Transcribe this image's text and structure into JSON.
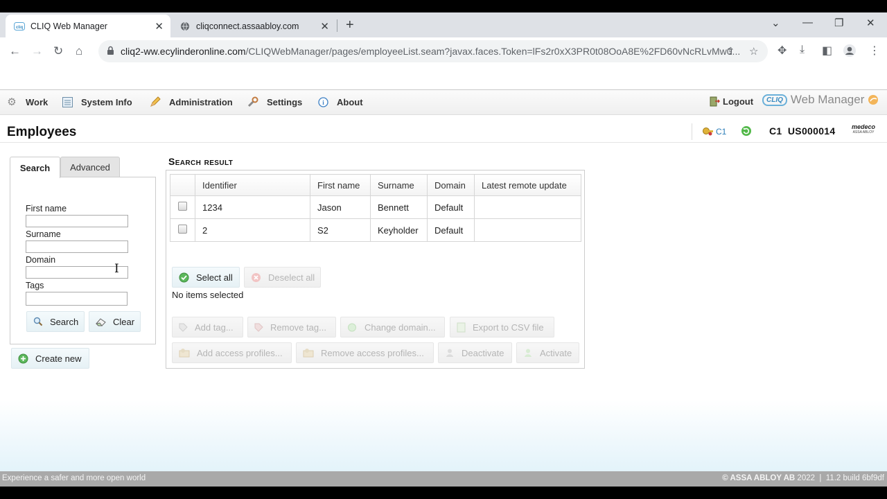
{
  "browser": {
    "tabs": [
      {
        "title": "CLIQ Web Manager",
        "favicon": "cliq-icon"
      },
      {
        "title": "cliqconnect.assaabloy.com",
        "favicon": "globe-icon"
      }
    ],
    "url_host": "cliq2-ww.ecylinderonline.com",
    "url_path": "/CLIQWebManager/pages/employeeList.seam?javax.faces.Token=lFs2r0xX3PR0t08OoA8E%2FD60vNcRLvMw0..."
  },
  "menu": {
    "items": [
      {
        "label": "Work",
        "icon": "gear-icon"
      },
      {
        "label": "System Info",
        "icon": "info-sheet-icon"
      },
      {
        "label": "Administration",
        "icon": "pencil-icon"
      },
      {
        "label": "Settings",
        "icon": "wrench-icon"
      },
      {
        "label": "About",
        "icon": "info-icon"
      }
    ],
    "logout": "Logout",
    "brand_badge": "CLIQ",
    "brand_text": "Web Manager"
  },
  "header": {
    "title": "Employees",
    "c1_badge": "C1",
    "user_prefix": "C1",
    "user_id": "US000014",
    "logo_top": "medeco",
    "logo_bottom": "ASSA ABLOY"
  },
  "search": {
    "tabs": [
      "Search",
      "Advanced"
    ],
    "fields": [
      {
        "label": "First name",
        "value": ""
      },
      {
        "label": "Surname",
        "value": ""
      },
      {
        "label": "Domain",
        "value": ""
      },
      {
        "label": "Tags",
        "value": ""
      }
    ],
    "search_button": "Search",
    "clear_button": "Clear",
    "create_button": "Create new"
  },
  "results": {
    "title": "Search result",
    "columns": [
      "Identifier",
      "First name",
      "Surname",
      "Domain",
      "Latest remote update"
    ],
    "rows": [
      [
        "1234",
        "Jason",
        "Bennett",
        "Default",
        ""
      ],
      [
        "2",
        "S2",
        "Keyholder",
        "Default",
        ""
      ]
    ],
    "select_all": "Select all",
    "deselect_all": "Deselect all",
    "selection_status": "No items selected",
    "actions_row1": [
      "Add tag...",
      "Remove tag...",
      "Change domain...",
      "Export to CSV file"
    ],
    "actions_row2": [
      "Add access profiles...",
      "Remove access profiles...",
      "Deactivate",
      "Activate"
    ]
  },
  "status": {
    "left": "Experience a safer and more open world",
    "copyright": "© ASSA ABLOY AB",
    "year": "2022",
    "build": "11.2 build 6bf9df"
  }
}
